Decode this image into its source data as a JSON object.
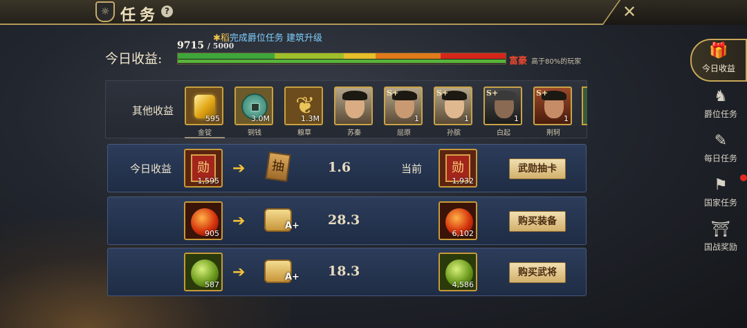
{
  "header": {
    "title": "任务",
    "emblem": "☼",
    "help": "?",
    "close": "✕"
  },
  "tip": {
    "prefix": "✱稻",
    "text": "完成爵位任务 建筑升级"
  },
  "income": {
    "label": "今日收益:",
    "current": "9715",
    "max": "/ 5000",
    "progress_fraction": 1.0,
    "rank_name": "富豪",
    "rank_desc": "高于80%的玩家"
  },
  "other": {
    "label": "其他收益",
    "items": [
      {
        "name": "金锭",
        "qty": "595",
        "kind": "gold"
      },
      {
        "name": "铜钱",
        "qty": "3.0M",
        "kind": "coin"
      },
      {
        "name": "粮草",
        "qty": "1.3M",
        "kind": "grain"
      },
      {
        "name": "苏秦",
        "qty": "",
        "kind": "hero"
      },
      {
        "name": "屈原",
        "qty": "1",
        "kind": "hero-s"
      },
      {
        "name": "孙膑",
        "qty": "1",
        "kind": "hero-s"
      },
      {
        "name": "白起",
        "qty": "1",
        "kind": "hero-s"
      },
      {
        "name": "荆轲",
        "qty": "1",
        "kind": "hero-s"
      }
    ]
  },
  "rows": [
    {
      "label": "今日收益",
      "source_qty": "1,595",
      "source_glyph": "勋",
      "target_glyph": "抽",
      "rate": "1.6",
      "current_label": "当前",
      "current_qty": "1,932",
      "action": "武勋抽卡"
    },
    {
      "label": "",
      "source_qty": "905",
      "source_glyph": "",
      "target_glyph": "",
      "rate": "28.3",
      "current_label": "",
      "current_qty": "6,102",
      "action": "购买装备"
    },
    {
      "label": "",
      "source_qty": "587",
      "source_glyph": "",
      "target_glyph": "",
      "rate": "18.3",
      "current_label": "",
      "current_qty": "4,586",
      "action": "购买武将"
    }
  ],
  "sidebar": [
    {
      "label": "今日收益",
      "icon": "gift-icon",
      "glyph": "🎁",
      "active": true
    },
    {
      "label": "爵位任务",
      "icon": "horse-icon",
      "glyph": "♞",
      "active": false
    },
    {
      "label": "每日任务",
      "icon": "scroll-icon",
      "glyph": "✎",
      "active": false
    },
    {
      "label": "国家任务",
      "icon": "flag-icon",
      "glyph": "⚑",
      "active": false
    },
    {
      "label": "国战奖励",
      "icon": "palace-icon",
      "glyph": "⛩",
      "active": false
    }
  ],
  "colors": {
    "accent": "#c9a85a",
    "rank": "#e4472f",
    "tip": "#7fd0ff",
    "row_bg": "#2c3d5b"
  }
}
